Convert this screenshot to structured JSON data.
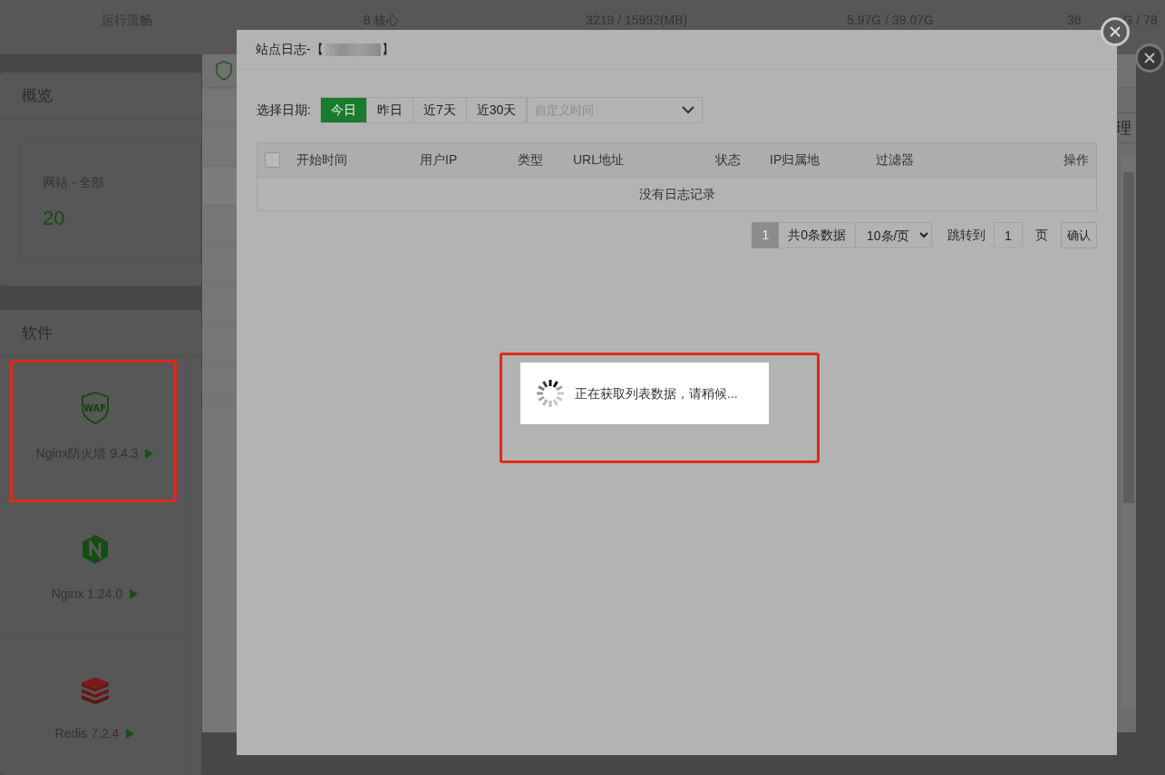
{
  "status_row": [
    "运行流畅",
    "8 核心",
    "3219 / 15992(MB)",
    "5.97G / 39.07G"
  ],
  "status_cut": [
    "36",
    "G / 78"
  ],
  "overview": {
    "title": "概览",
    "stat_label": "网站 - 全部",
    "stat_value": "20"
  },
  "software": {
    "title": "软件",
    "items": [
      {
        "name": "Nginx防火墙 9.4.3",
        "kind": "waf",
        "icon_text": "WAF",
        "highlighted": true
      },
      {
        "name": "Nginx 1.24.0",
        "kind": "nginx",
        "highlighted": false
      },
      {
        "name": "Redis 7.2.4",
        "kind": "redis",
        "highlighted": false
      }
    ]
  },
  "site_dialog": {
    "button_fragment": "理"
  },
  "log_dialog": {
    "title_prefix": "站点日志-【",
    "title_suffix": "】",
    "date_label": "选择日期:",
    "date_ranges": [
      {
        "label": "今日",
        "selected": true
      },
      {
        "label": "昨日",
        "selected": false
      },
      {
        "label": "近7天",
        "selected": false
      },
      {
        "label": "近30天",
        "selected": false
      }
    ],
    "custom_time": {
      "placeholder": "自定义时间"
    },
    "table": {
      "select_all_checked": false,
      "columns": [
        "开始时间",
        "用户IP",
        "类型",
        "URL地址",
        "状态",
        "IP归属地",
        "过滤器",
        "操作"
      ],
      "empty_text": "没有日志记录"
    },
    "pagination": {
      "current_page": "1",
      "total": "共0条数据",
      "page_size": "10条/页",
      "jump_label": "跳转到",
      "jump_value": "1",
      "page_unit": "页",
      "confirm": "确认"
    }
  },
  "loading": {
    "message": "正在获取列表数据，请稍候...",
    "highlighted": true
  }
}
